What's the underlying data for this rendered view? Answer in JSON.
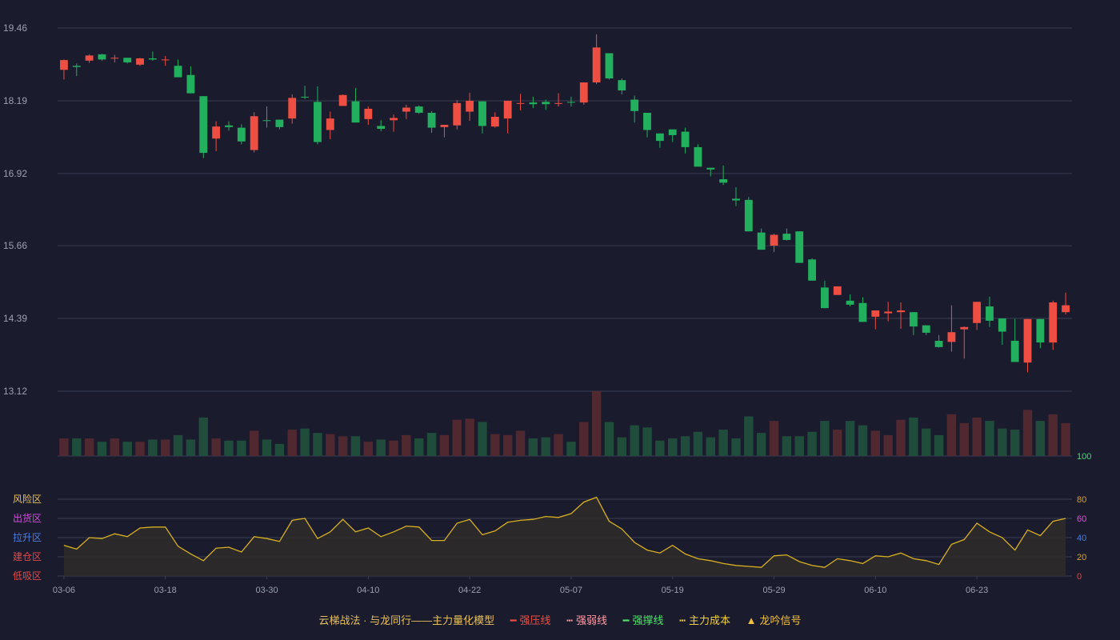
{
  "chart_data": {
    "type": "candlestick",
    "price_axis": {
      "ticks": [
        19.46,
        18.19,
        16.92,
        15.66,
        14.39,
        13.12
      ],
      "range": [
        13.12,
        19.46
      ]
    },
    "x_labels": [
      "03-06",
      "03-18",
      "03-30",
      "04-10",
      "04-22",
      "05-07",
      "05-19",
      "05-29",
      "06-10",
      "06-23"
    ],
    "x_label_index": [
      0,
      8,
      16,
      24,
      32,
      40,
      48,
      56,
      64,
      72
    ],
    "ohlc": [
      [
        18.73,
        18.91,
        18.56,
        18.9
      ],
      [
        18.8,
        18.84,
        18.62,
        18.78
      ],
      [
        18.89,
        19.0,
        18.85,
        18.98
      ],
      [
        19.0,
        19.01,
        18.89,
        18.91
      ],
      [
        18.94,
        18.99,
        18.86,
        18.94
      ],
      [
        18.94,
        18.94,
        18.84,
        18.86
      ],
      [
        18.82,
        18.94,
        18.8,
        18.93
      ],
      [
        18.93,
        19.05,
        18.89,
        18.91
      ],
      [
        18.91,
        18.97,
        18.8,
        18.91
      ],
      [
        18.8,
        18.91,
        18.66,
        18.6
      ],
      [
        18.64,
        18.79,
        18.33,
        18.32
      ],
      [
        18.27,
        18.27,
        17.19,
        17.28
      ],
      [
        17.53,
        17.83,
        17.31,
        17.74
      ],
      [
        17.76,
        17.83,
        17.67,
        17.73
      ],
      [
        17.72,
        17.78,
        17.43,
        17.48
      ],
      [
        17.33,
        17.99,
        17.29,
        17.92
      ],
      [
        17.85,
        18.09,
        17.72,
        17.84
      ],
      [
        17.86,
        17.86,
        17.69,
        17.73
      ],
      [
        17.88,
        18.3,
        17.79,
        18.24
      ],
      [
        18.26,
        18.45,
        18.22,
        18.25
      ],
      [
        18.17,
        18.44,
        17.43,
        17.47
      ],
      [
        17.68,
        18.0,
        17.52,
        17.88
      ],
      [
        18.1,
        18.3,
        18.1,
        18.29
      ],
      [
        18.18,
        18.41,
        17.83,
        17.81
      ],
      [
        17.87,
        18.09,
        17.77,
        18.05
      ],
      [
        17.75,
        17.85,
        17.66,
        17.7
      ],
      [
        17.85,
        17.95,
        17.65,
        17.89
      ],
      [
        18.0,
        18.12,
        17.87,
        18.07
      ],
      [
        18.09,
        18.11,
        17.96,
        17.98
      ],
      [
        17.98,
        18.01,
        17.63,
        17.72
      ],
      [
        17.73,
        17.75,
        17.55,
        17.77
      ],
      [
        17.76,
        18.2,
        17.69,
        18.15
      ],
      [
        18.0,
        18.33,
        17.84,
        18.19
      ],
      [
        18.18,
        18.18,
        17.62,
        17.75
      ],
      [
        17.74,
        17.99,
        17.72,
        17.91
      ],
      [
        17.88,
        17.91,
        17.62,
        18.19
      ],
      [
        18.15,
        18.31,
        18.02,
        18.15
      ],
      [
        18.16,
        18.26,
        18.06,
        18.13
      ],
      [
        18.17,
        18.21,
        18.03,
        18.13
      ],
      [
        18.15,
        18.32,
        18.09,
        18.15
      ],
      [
        18.17,
        18.26,
        18.09,
        18.16
      ],
      [
        18.16,
        18.5,
        18.12,
        18.51
      ],
      [
        18.51,
        19.35,
        18.48,
        19.12
      ],
      [
        19.02,
        18.97,
        18.56,
        18.58
      ],
      [
        18.55,
        18.58,
        18.3,
        18.37
      ],
      [
        18.21,
        18.28,
        17.81,
        18.01
      ],
      [
        17.98,
        17.96,
        17.55,
        17.68
      ],
      [
        17.62,
        17.59,
        17.37,
        17.49
      ],
      [
        17.69,
        17.68,
        17.47,
        17.59
      ],
      [
        17.65,
        17.72,
        17.27,
        17.38
      ],
      [
        17.38,
        17.43,
        17.06,
        17.04
      ],
      [
        17.02,
        17.02,
        16.87,
        16.99
      ],
      [
        16.82,
        17.06,
        16.72,
        16.76
      ],
      [
        16.48,
        16.68,
        16.35,
        16.45
      ],
      [
        16.46,
        16.51,
        16.0,
        15.91
      ],
      [
        15.89,
        15.96,
        15.74,
        15.59
      ],
      [
        15.66,
        15.87,
        15.55,
        15.85
      ],
      [
        15.87,
        15.96,
        15.75,
        15.76
      ],
      [
        15.91,
        15.91,
        15.58,
        15.36
      ],
      [
        15.42,
        15.44,
        15.05,
        15.05
      ],
      [
        14.93,
        15.05,
        14.66,
        14.57
      ],
      [
        14.8,
        14.95,
        14.8,
        14.95
      ],
      [
        14.7,
        14.81,
        14.6,
        14.63
      ],
      [
        14.66,
        14.76,
        14.45,
        14.33
      ],
      [
        14.42,
        14.29,
        14.2,
        14.53
      ],
      [
        14.48,
        14.68,
        14.34,
        14.51
      ],
      [
        14.5,
        14.67,
        14.21,
        14.53
      ],
      [
        14.5,
        14.33,
        14.1,
        14.25
      ],
      [
        14.27,
        14.13,
        14.1,
        14.14
      ],
      [
        14.0,
        14.1,
        13.88,
        13.89
      ],
      [
        13.98,
        14.62,
        13.81,
        14.15
      ],
      [
        14.2,
        14.25,
        13.69,
        14.24
      ],
      [
        14.31,
        14.67,
        14.19,
        14.68
      ],
      [
        14.6,
        14.77,
        14.24,
        14.35
      ],
      [
        14.39,
        14.37,
        13.93,
        14.16
      ],
      [
        14.0,
        14.38,
        13.95,
        13.63
      ],
      [
        13.62,
        14.38,
        13.45,
        14.38
      ],
      [
        14.38,
        14.38,
        13.87,
        13.97
      ],
      [
        13.97,
        14.7,
        13.84,
        14.67
      ],
      [
        14.5,
        14.84,
        14.46,
        14.62
      ]
    ],
    "volume": [
      16,
      16,
      16,
      13,
      16,
      13,
      13,
      15,
      15,
      19,
      15,
      35,
      16,
      14,
      14,
      23,
      15,
      11,
      24,
      25,
      21,
      20,
      18,
      18,
      13,
      15,
      14,
      19,
      16,
      21,
      19,
      33,
      34,
      31,
      20,
      19,
      23,
      16,
      17,
      20,
      13,
      31,
      59,
      31,
      17,
      28,
      26,
      14,
      16,
      18,
      22,
      17,
      24,
      16,
      36,
      21,
      32,
      18,
      18,
      22,
      32,
      24,
      32,
      28,
      23,
      19,
      33,
      35,
      25,
      19,
      38,
      30,
      35,
      32,
      25,
      24,
      42,
      32,
      38,
      30
    ],
    "vol_colors": [
      "#4f2830",
      "#204c3b"
    ],
    "indicator": {
      "ylim": [
        0,
        100
      ],
      "right_ticks": [
        "100",
        "80",
        "60",
        "40",
        "20",
        "0"
      ],
      "right_tick_colors": [
        "#3ce06e",
        "#d9a42e",
        "#e04ede",
        "#4a7fe2",
        "#d9a42e",
        "#e04848"
      ],
      "zones": [
        "风险区",
        "出货区",
        "拉升区",
        "建仓区",
        "低吸区"
      ],
      "zone_colors": [
        "#e8c15a",
        "#d64ce0",
        "#4a7fe2",
        "#e04848",
        "#e04848"
      ],
      "values": [
        32,
        28,
        40,
        39,
        44,
        41,
        50,
        51,
        51,
        31,
        23,
        16,
        29,
        30,
        25,
        41,
        39,
        36,
        58,
        60,
        39,
        46,
        59,
        46,
        50,
        41,
        46,
        52,
        51,
        37,
        37,
        55,
        59,
        43,
        47,
        56,
        58,
        59,
        62,
        61,
        65,
        77,
        82,
        57,
        49,
        35,
        27,
        24,
        32,
        23,
        18,
        16,
        13,
        11,
        10,
        9,
        21,
        22,
        15,
        11,
        9,
        18,
        16,
        13,
        21,
        20,
        24,
        18,
        16,
        12,
        33,
        38,
        55,
        46,
        40,
        27,
        48,
        42,
        57,
        60
      ],
      "line_color": "#d8b020",
      "fill_color": "#2f2b2a"
    },
    "colors": {
      "up": "#ee4f42",
      "down": "#22b05e",
      "grid": "#3a3c52",
      "axis_text": "#9aa0b2",
      "background": "#1b1b2e"
    }
  },
  "legend": {
    "title": "云梯战法 · 与龙同行——主力量化模型",
    "items": [
      {
        "mark": "━",
        "label": "强压线",
        "color": "#ee4f42"
      },
      {
        "mark": "┅",
        "label": "强弱线",
        "color": "#ff9ea8"
      },
      {
        "mark": "━",
        "label": "强撑线",
        "color": "#4ee46a"
      },
      {
        "mark": "┅",
        "label": "主力成本",
        "color": "#f0d040"
      },
      {
        "mark": "▲",
        "label": "龙吟信号",
        "color": "#f0c040"
      }
    ]
  }
}
